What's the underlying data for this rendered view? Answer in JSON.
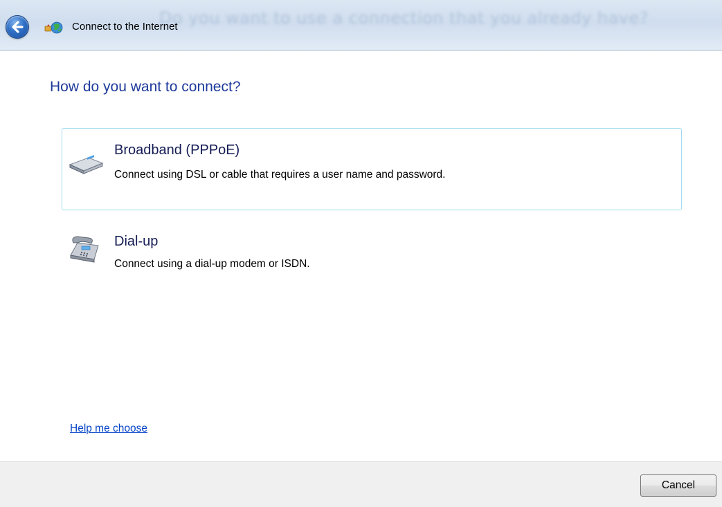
{
  "window": {
    "title": "Connect to the Internet",
    "ghost_text": "Do you want to use a connection that you already have?",
    "back_icon": "back-arrow-icon",
    "title_icon": "network-globe-icon"
  },
  "main": {
    "heading": "How do you want to connect?",
    "options": [
      {
        "title": "Broadband (PPPoE)",
        "description": "Connect using DSL or cable that requires a user name and password.",
        "icon": "broadband-modem-icon",
        "selected": true
      },
      {
        "title": "Dial-up",
        "description": "Connect using a dial-up modem or ISDN.",
        "icon": "dialup-phone-icon",
        "selected": false
      }
    ],
    "help_link": "Help me choose"
  },
  "footer": {
    "cancel_label": "Cancel"
  },
  "colors": {
    "heading": "#1e3a9a",
    "link": "#0645c8",
    "selection_border": "#9fdcef",
    "footer_bg": "#f0f0f0"
  }
}
